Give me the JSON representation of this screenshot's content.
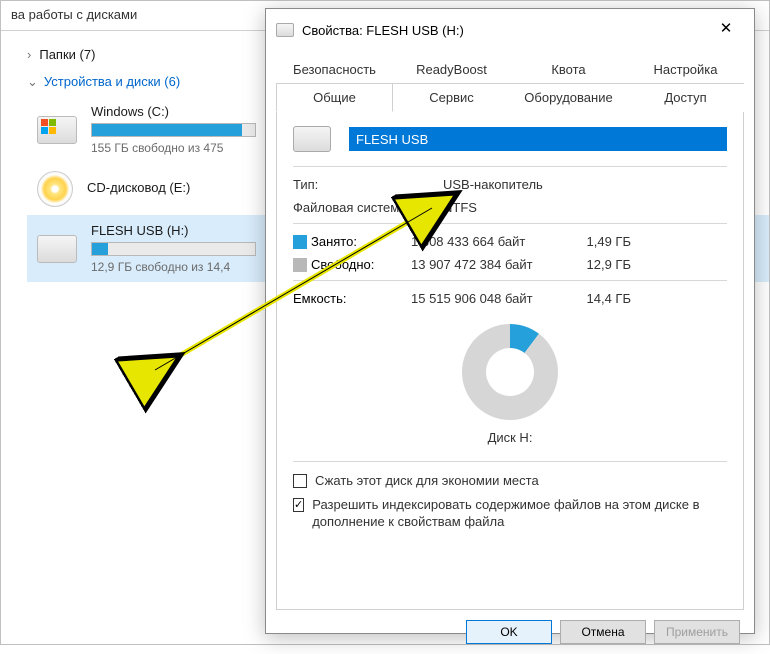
{
  "explorer": {
    "header": "ва работы с дисками",
    "folders_label": "Папки (7)",
    "devices_label": "Устройства и диски (6)",
    "drives": [
      {
        "name": "Windows (C:)",
        "free": "155 ГБ свободно из 475",
        "fill": 92,
        "type": "hdd"
      },
      {
        "name": "CD-дисковод (E:)",
        "free": "",
        "fill": 0,
        "type": "cd"
      },
      {
        "name": "FLESH USB (H:)",
        "free": "12,9 ГБ свободно из 14,4",
        "fill": 10,
        "type": "usb"
      }
    ]
  },
  "dialog": {
    "title": "Свойства: FLESH USB (H:)",
    "tabs_top": [
      "Безопасность",
      "ReadyBoost",
      "Квота",
      "Настройка"
    ],
    "tabs_bottom": [
      "Общие",
      "Сервис",
      "Оборудование",
      "Доступ"
    ],
    "active_tab": "Общие",
    "name_value": "FLESH USB",
    "type_label": "Тип:",
    "type_value": "USB-накопитель",
    "fs_label": "Файловая система:",
    "fs_value": "NTFS",
    "used_label": "Занято:",
    "used_bytes": "1 608 433 664 байт",
    "used_gb": "1,49 ГБ",
    "free_label": "Свободно:",
    "free_bytes": "13 907 472 384 байт",
    "free_gb": "12,9 ГБ",
    "capacity_label": "Емкость:",
    "capacity_bytes": "15 515 906 048 байт",
    "capacity_gb": "14,4 ГБ",
    "disk_label": "Диск H:",
    "compress_label": "Сжать этот диск для экономии места",
    "index_label": "Разрешить индексировать содержимое файлов на этом диске в дополнение к свойствам файла",
    "btn_ok": "OK",
    "btn_cancel": "Отмена",
    "btn_apply": "Применить"
  }
}
